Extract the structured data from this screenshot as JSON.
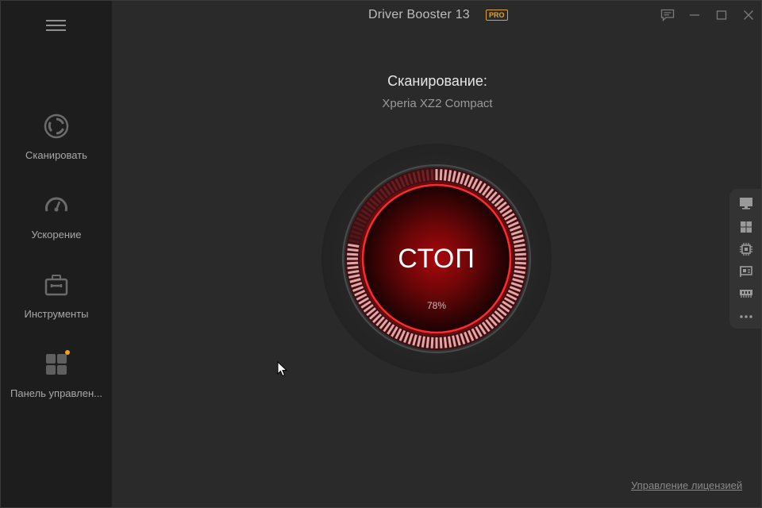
{
  "window": {
    "title": "Driver Booster 13",
    "badge": "PRO",
    "controls": [
      "feedback-icon",
      "minimize-icon",
      "maximize-icon",
      "close-icon"
    ]
  },
  "sidebar": {
    "items": [
      {
        "label": "Сканировать",
        "icon": "scan-icon"
      },
      {
        "label": "Ускорение",
        "icon": "speedometer-icon"
      },
      {
        "label": "Инструменты",
        "icon": "toolbox-icon"
      },
      {
        "label": "Панель управлен...",
        "icon": "dashboard-icon",
        "has_notification": true
      }
    ]
  },
  "main": {
    "status_title": "Сканирование:",
    "status_device": "Xperia XZ2 Compact",
    "stop_label": "СТОП",
    "progress_text": "78%",
    "progress": 0.78
  },
  "dock": {
    "items": [
      "monitor-icon",
      "windows-icon",
      "chip-icon",
      "network-card-icon",
      "memory-icon",
      "more-icon"
    ]
  },
  "footer": {
    "license_link": "Управление лицензией"
  },
  "colors": {
    "accent": "#e01e24",
    "pro": "#e0a52a",
    "sidebar_bg": "#1d1d1d",
    "main_bg": "#2a2a2a",
    "notification": "#f0a61d"
  }
}
